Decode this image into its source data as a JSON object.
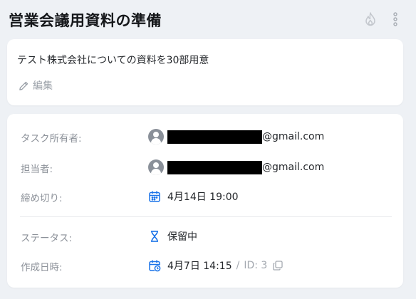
{
  "header": {
    "title": "営業会議用資料の準備"
  },
  "description": {
    "text": "テスト株式会社についての資料を30部用意",
    "edit_label": "編集"
  },
  "details": {
    "owner_label": "タスク所有者:",
    "owner_email_domain": "@gmail.com",
    "assignee_label": "担当者:",
    "assignee_email_domain": "@gmail.com",
    "deadline_label": "締め切り:",
    "deadline_value": "4月14日 19:00",
    "status_label": "ステータス:",
    "status_value": "保留中",
    "created_label": "作成日時:",
    "created_value": "4月7日 14:15",
    "separator": "/",
    "id_text": "ID: 3"
  },
  "colors": {
    "background": "#eef1f5",
    "accent_icon": "#1a73e8",
    "label": "#8c9199"
  },
  "icons": [
    "flame-icon",
    "more-vertical-icon",
    "pencil-icon",
    "user-avatar-icon",
    "calendar-icon",
    "hourglass-icon",
    "calendar-clock-icon",
    "copy-icon"
  ]
}
